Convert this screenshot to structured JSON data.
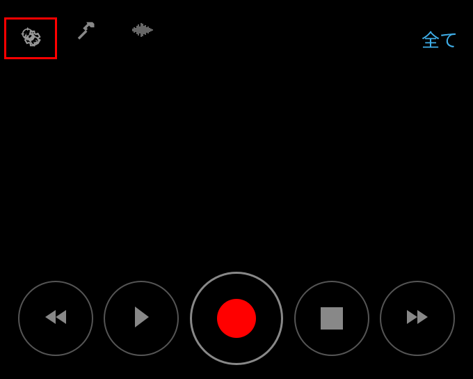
{
  "toolbar": {
    "settings_icon": "settings-gear",
    "tools_icon": "hammer",
    "waveform_icon": "waveform",
    "all_label": "全て"
  },
  "controls": {
    "rewind": "rewind",
    "play": "play",
    "record": "record",
    "stop": "stop",
    "forward": "fast-forward"
  },
  "highlight": {
    "target": "settings-button",
    "color": "#ff0000"
  }
}
